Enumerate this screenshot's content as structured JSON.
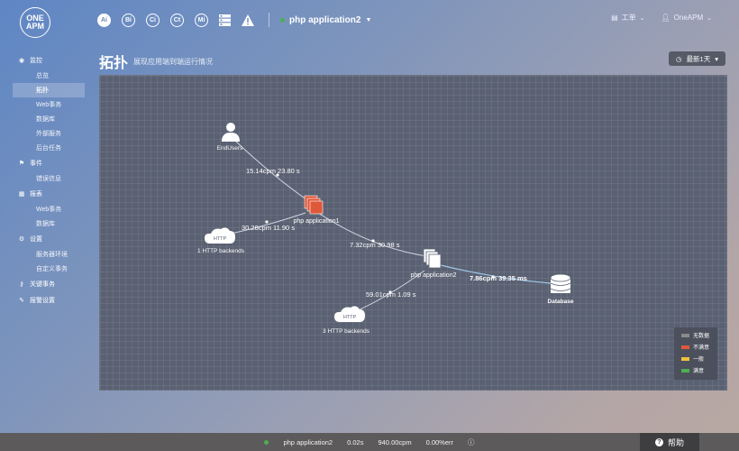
{
  "brand": {
    "line1": "ONE",
    "line2": "APM"
  },
  "topnav": {
    "icons": [
      {
        "name": "ai-icon",
        "text": "Ai"
      },
      {
        "name": "bi-icon",
        "text": "Bi"
      },
      {
        "name": "ci-icon",
        "text": "Ci"
      },
      {
        "name": "ct-icon",
        "text": "Ct"
      },
      {
        "name": "mi-icon",
        "text": "Mi"
      }
    ],
    "app_name": "php application2"
  },
  "topright": {
    "tickets": "工单",
    "user": "OneAPM"
  },
  "sidebar": {
    "monitor": "监控",
    "monitor_items": [
      "总览",
      "拓扑",
      "Web事务",
      "数据库",
      "外部服务",
      "后台任务"
    ],
    "events": "事件",
    "events_items": [
      "错误信息"
    ],
    "reports": "报表",
    "reports_items": [
      "Web事务",
      "数据库"
    ],
    "settings": "设置",
    "settings_items": [
      "服务器环境",
      "自定义事务"
    ],
    "key_tx": "关键事务",
    "alert": "报警设置"
  },
  "page": {
    "title": "拓扑",
    "subtitle": "展现应用端到端运行情况",
    "time_range": "最新1天"
  },
  "topology": {
    "nodes": {
      "endusers": "EndUsers",
      "app1": "php application1",
      "http1_badge": "HTTP",
      "http1": "1 HTTP backends",
      "app2": "php application2",
      "db": "Database",
      "http3_badge": "HTTP",
      "http3": "3 HTTP backends"
    },
    "edges": {
      "e1": "15.14cpm 23.80 s",
      "e2": "30.28cpm 11.90 s",
      "e3": "7.32cpm 30.98 s",
      "e4": "7.86cpm 39.35 ms",
      "e5": "59.01cpm 1.09 s"
    }
  },
  "legend": {
    "items": [
      {
        "label": "无数据",
        "color": "#8a8a8a"
      },
      {
        "label": "不满意",
        "color": "#e0583a"
      },
      {
        "label": "一般",
        "color": "#f0c040"
      },
      {
        "label": "满意",
        "color": "#4caf50"
      }
    ]
  },
  "bottom": {
    "app": "php application2",
    "resp": "0.02s",
    "throughput": "940.00cpm",
    "error": "0.00%err"
  },
  "help": "帮助"
}
